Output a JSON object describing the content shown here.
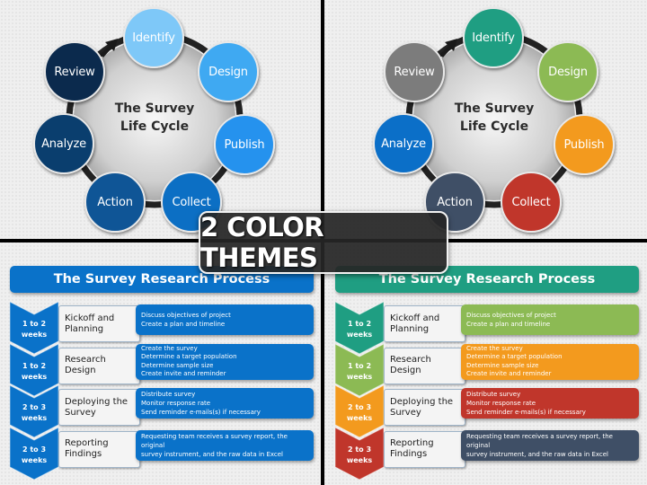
{
  "banner": {
    "text": "2 COLOR THEMES"
  },
  "cycles": [
    {
      "theme": "blue",
      "center_title_line1": "The Survey",
      "center_title_line2": "Life Cycle",
      "nodes": [
        {
          "label": "Identify",
          "color": "#7ec8f8"
        },
        {
          "label": "Design",
          "color": "#3fa9f2"
        },
        {
          "label": "Publish",
          "color": "#2592ee"
        },
        {
          "label": "Collect",
          "color": "#0c6fc4"
        },
        {
          "label": "Action",
          "color": "#0f5596"
        },
        {
          "label": "Analyze",
          "color": "#0a3e6e"
        },
        {
          "label": "Review",
          "color": "#0b2a4d"
        }
      ]
    },
    {
      "theme": "multicolor",
      "center_title_line1": "The Survey",
      "center_title_line2": "Life Cycle",
      "nodes": [
        {
          "label": "Identify",
          "color": "#1f9e82"
        },
        {
          "label": "Design",
          "color": "#8cba54"
        },
        {
          "label": "Publish",
          "color": "#f39a1e"
        },
        {
          "label": "Collect",
          "color": "#c0362b"
        },
        {
          "label": "Action",
          "color": "#3f4f66"
        },
        {
          "label": "Analyze",
          "color": "#0b6fc8"
        },
        {
          "label": "Review",
          "color": "#7c7c7c"
        }
      ]
    }
  ],
  "processes": [
    {
      "theme": "blue",
      "title": "The Survey Research Process",
      "title_color": "#0a72c9",
      "steps": [
        {
          "duration_line1": "1 to 2",
          "duration_line2": "weeks",
          "label_line1": "Kickoff and",
          "label_line2": "Planning",
          "details": [
            "Discuss objectives of project",
            "Create a plan and timeline"
          ],
          "chevron_color": "#0a72c9",
          "desc_color": "#0a72c9"
        },
        {
          "duration_line1": "1 to 2",
          "duration_line2": "weeks",
          "label_line1": "Research Design",
          "label_line2": "",
          "details": [
            "Create the survey",
            "Determine a target population",
            "Determine sample size",
            "Create invite and reminder"
          ],
          "chevron_color": "#0a72c9",
          "desc_color": "#0a72c9"
        },
        {
          "duration_line1": "2 to 3",
          "duration_line2": "weeks",
          "label_line1": "Deploying the",
          "label_line2": "Survey",
          "details": [
            "Distribute survey",
            "Monitor response rate",
            "Send reminder e-mails(s) if necessary"
          ],
          "chevron_color": "#0a72c9",
          "desc_color": "#0a72c9"
        },
        {
          "duration_line1": "2 to 3",
          "duration_line2": "weeks",
          "label_line1": "Reporting",
          "label_line2": "Findings",
          "details": [
            "Requesting team receives a survey report, the original",
            "survey instrument, and the raw data in Excel"
          ],
          "chevron_color": "#0a72c9",
          "desc_color": "#0a72c9"
        }
      ]
    },
    {
      "theme": "multicolor",
      "title": "The Survey Research Process",
      "title_color": "#1f9e82",
      "steps": [
        {
          "duration_line1": "1 to 2",
          "duration_line2": "weeks",
          "label_line1": "Kickoff and",
          "label_line2": "Planning",
          "details": [
            "Discuss objectives of project",
            "Create a plan and timeline"
          ],
          "chevron_color": "#1f9e82",
          "desc_color": "#8cba54"
        },
        {
          "duration_line1": "1 to 2",
          "duration_line2": "weeks",
          "label_line1": "Research Design",
          "label_line2": "",
          "details": [
            "Create the survey",
            "Determine a target population",
            "Determine sample size",
            "Create invite and reminder"
          ],
          "chevron_color": "#8cba54",
          "desc_color": "#f39a1e"
        },
        {
          "duration_line1": "2 to 3",
          "duration_line2": "weeks",
          "label_line1": "Deploying the",
          "label_line2": "Survey",
          "details": [
            "Distribute survey",
            "Monitor response rate",
            "Send reminder e-mails(s) if necessary"
          ],
          "chevron_color": "#f39a1e",
          "desc_color": "#c0362b"
        },
        {
          "duration_line1": "2 to 3",
          "duration_line2": "weeks",
          "label_line1": "Reporting",
          "label_line2": "Findings",
          "details": [
            "Requesting team receives a survey report, the original",
            "survey instrument, and the raw data in Excel"
          ],
          "chevron_color": "#c0362b",
          "desc_color": "#3f4f66"
        }
      ]
    }
  ]
}
